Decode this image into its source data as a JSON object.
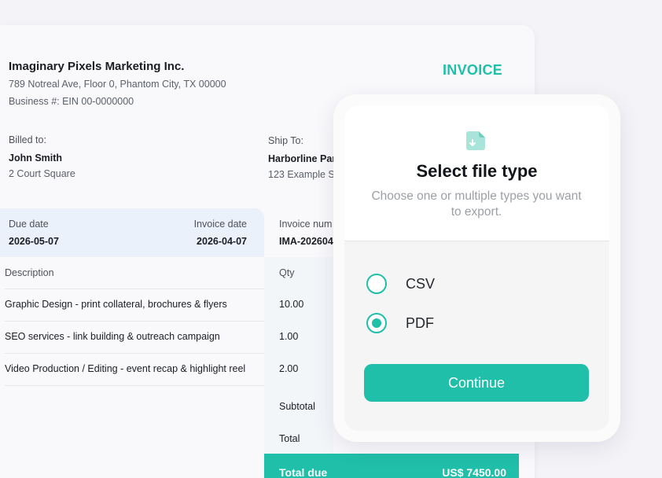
{
  "company": {
    "name": "Imaginary Pixels Marketing Inc.",
    "address": "789 Notreal Ave, Floor 0, Phantom City, TX 00000",
    "ein": "Business #: EIN 00-0000000"
  },
  "invoice_title": "INVOICE",
  "billed_to": {
    "label": "Billed to:",
    "name": "John Smith",
    "address": "2 Court Square"
  },
  "ship_to": {
    "label": "Ship To:",
    "name": "Harborline Par",
    "address": "123 Example S"
  },
  "dates": {
    "due_label": "Due date",
    "due_value": "2026-05-07",
    "invoice_date_label": "Invoice date",
    "invoice_date_value": "2026-04-07",
    "invoice_num_label": "Invoice num",
    "invoice_num_value": "IMA-202604"
  },
  "table": {
    "headers": {
      "description": "Description",
      "qty": "Qty"
    },
    "rows": [
      {
        "description": "Graphic Design - print collateral, brochures & flyers",
        "qty": "10.00"
      },
      {
        "description": "SEO services - link building & outreach campaign",
        "qty": "1.00"
      },
      {
        "description": "Video Production / Editing - event recap & highlight reel",
        "qty": "2.00"
      }
    ]
  },
  "totals": {
    "subtotal_label": "Subtotal",
    "total_label": "Total",
    "total_due_label": "Total due",
    "total_due_value": "US$ 7450.00"
  },
  "modal": {
    "title": "Select file type",
    "subtitle": "Choose one or multiple types you want to export.",
    "options": [
      {
        "label": "CSV",
        "selected": false
      },
      {
        "label": "PDF",
        "selected": true
      }
    ],
    "continue_label": "Continue",
    "icon": "file-download-icon"
  },
  "colors": {
    "accent": "#20bfa9",
    "dates_bg": "#eaf1fb"
  }
}
